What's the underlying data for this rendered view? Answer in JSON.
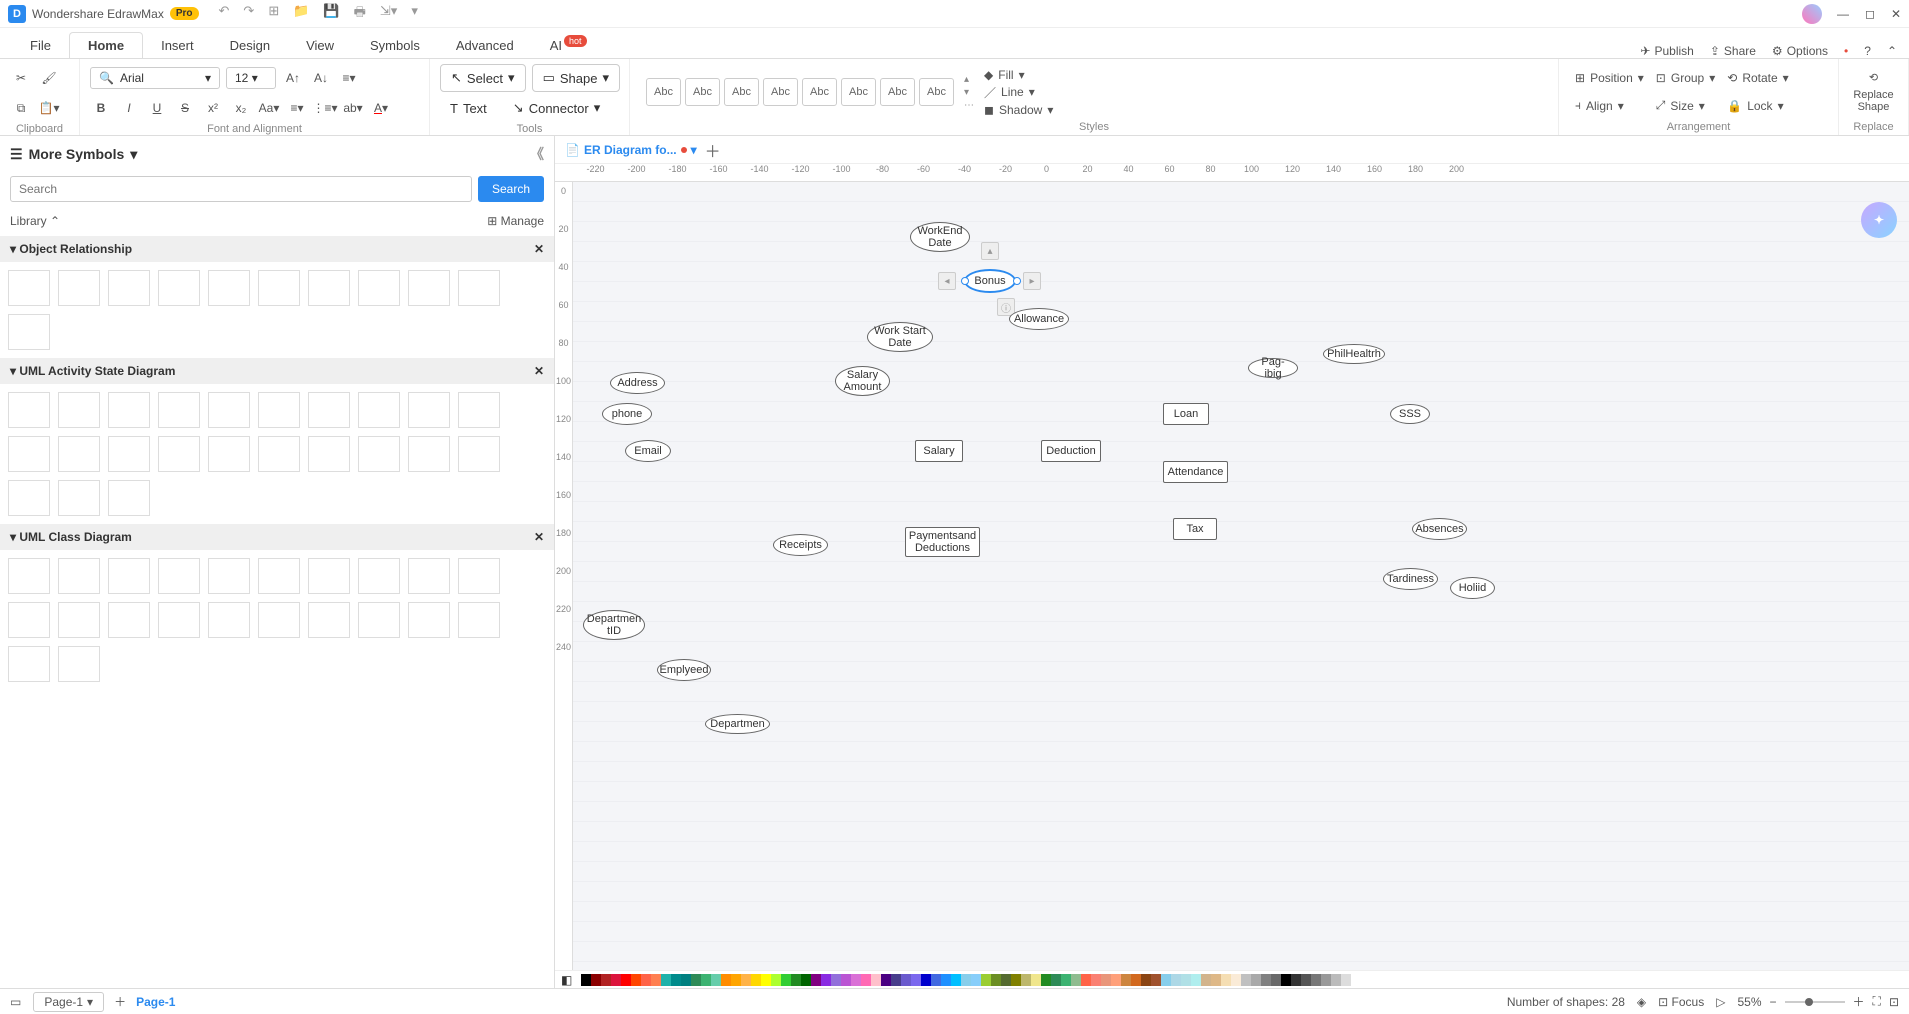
{
  "app": {
    "title": "Wondershare EdrawMax",
    "badge": "Pro"
  },
  "menu": {
    "tabs": [
      "File",
      "Home",
      "Insert",
      "Design",
      "View",
      "Symbols",
      "Advanced",
      "AI"
    ],
    "active": "Home",
    "ai_hot": "hot",
    "right": {
      "publish": "Publish",
      "share": "Share",
      "options": "Options"
    }
  },
  "ribbon": {
    "clipboard_label": "Clipboard",
    "font": {
      "name": "Arial",
      "size": "12"
    },
    "font_label": "Font and Alignment",
    "tools": {
      "select": "Select",
      "shape": "Shape",
      "text": "Text",
      "connector": "Connector",
      "label": "Tools"
    },
    "styles": {
      "items": [
        "Abc",
        "Abc",
        "Abc",
        "Abc",
        "Abc",
        "Abc",
        "Abc",
        "Abc"
      ],
      "fill": "Fill",
      "line": "Line",
      "shadow": "Shadow",
      "label": "Styles"
    },
    "arrange": {
      "position": "Position",
      "group": "Group",
      "rotate": "Rotate",
      "align": "Align",
      "size": "Size",
      "lock": "Lock",
      "label": "Arrangement"
    },
    "replace": {
      "btn": "Replace\nShape",
      "label": "Replace"
    }
  },
  "left": {
    "title": "More Symbols",
    "search_placeholder": "Search",
    "search_btn": "Search",
    "library": "Library",
    "manage": "Manage",
    "sections": [
      "Object Relationship",
      "UML Activity State Diagram",
      "UML Class Diagram"
    ]
  },
  "doc": {
    "tab": "ER Diagram fo...",
    "page": "Page-1"
  },
  "ruler_h": [
    "-220",
    "-200",
    "-180",
    "-160",
    "-140",
    "-120",
    "-100",
    "-80",
    "-60",
    "-40",
    "-20",
    "0",
    "20",
    "40",
    "60",
    "80",
    "100",
    "120",
    "140",
    "160",
    "180",
    "200"
  ],
  "ruler_v": [
    "0",
    "20",
    "40",
    "60",
    "80",
    "100",
    "120",
    "140",
    "160",
    "180",
    "200",
    "220",
    "240"
  ],
  "nodes": {
    "workend": "WorkEnd\nDate",
    "bonus": "Bonus",
    "allowance": "Allowance",
    "workstart": "Work Start\nDate",
    "salaryamt": "Salary\nAmount",
    "address": "Address",
    "phone": "phone",
    "email": "Email",
    "salary": "Salary",
    "deduction": "Deduction",
    "loan": "Loan",
    "pagibig": "Pag-ibig",
    "philhealth": "PhilHealtrh",
    "sss": "SSS",
    "attendance": "Attendance",
    "tax": "Tax",
    "receipts": "Receipts",
    "paydeduct": "Paymentsand\nDeductions",
    "deptid": "Departmen\ntID",
    "employed": "Emplyeed",
    "departmen": "Departmen",
    "absences": "Absences",
    "tardiness": "Tardiness",
    "holiid": "Holiid"
  },
  "status": {
    "shapes": "Number of shapes: 28",
    "focus": "Focus",
    "zoom": "55%"
  },
  "colors": [
    "#000",
    "#8b0000",
    "#b22222",
    "#dc143c",
    "#ff0000",
    "#ff4500",
    "#ff6347",
    "#ff7f50",
    "#20b2aa",
    "#008b8b",
    "#008080",
    "#2e8b57",
    "#3cb371",
    "#66cdaa",
    "#ff8c00",
    "#ffa500",
    "#ffb347",
    "#ffd700",
    "#ffff00",
    "#adff2f",
    "#32cd32",
    "#228b22",
    "#006400",
    "#800080",
    "#8a2be2",
    "#9370db",
    "#ba55d3",
    "#da70d6",
    "#ff69b4",
    "#ffc0cb",
    "#4b0082",
    "#483d8b",
    "#6a5acd",
    "#7b68ee",
    "#0000cd",
    "#4169e1",
    "#1e90ff",
    "#00bfff",
    "#87ceeb",
    "#87cefa",
    "#9acd32",
    "#6b8e23",
    "#556b2f",
    "#808000",
    "#bdb76b",
    "#f0e68c",
    "#228b22",
    "#2e8b57",
    "#3cb371",
    "#8fbc8f",
    "#ff6347",
    "#fa8072",
    "#e9967a",
    "#ffa07a",
    "#cd853f",
    "#d2691e",
    "#8b4513",
    "#a0522d",
    "#87ceeb",
    "#add8e6",
    "#b0e0e6",
    "#afeeee",
    "#d2b48c",
    "#deb887",
    "#f5deb3",
    "#faebd7",
    "#c0c0c0",
    "#a9a9a9",
    "#808080",
    "#696969",
    "#000",
    "#333",
    "#555",
    "#777",
    "#999",
    "#bbb",
    "#ddd",
    "#fff"
  ]
}
